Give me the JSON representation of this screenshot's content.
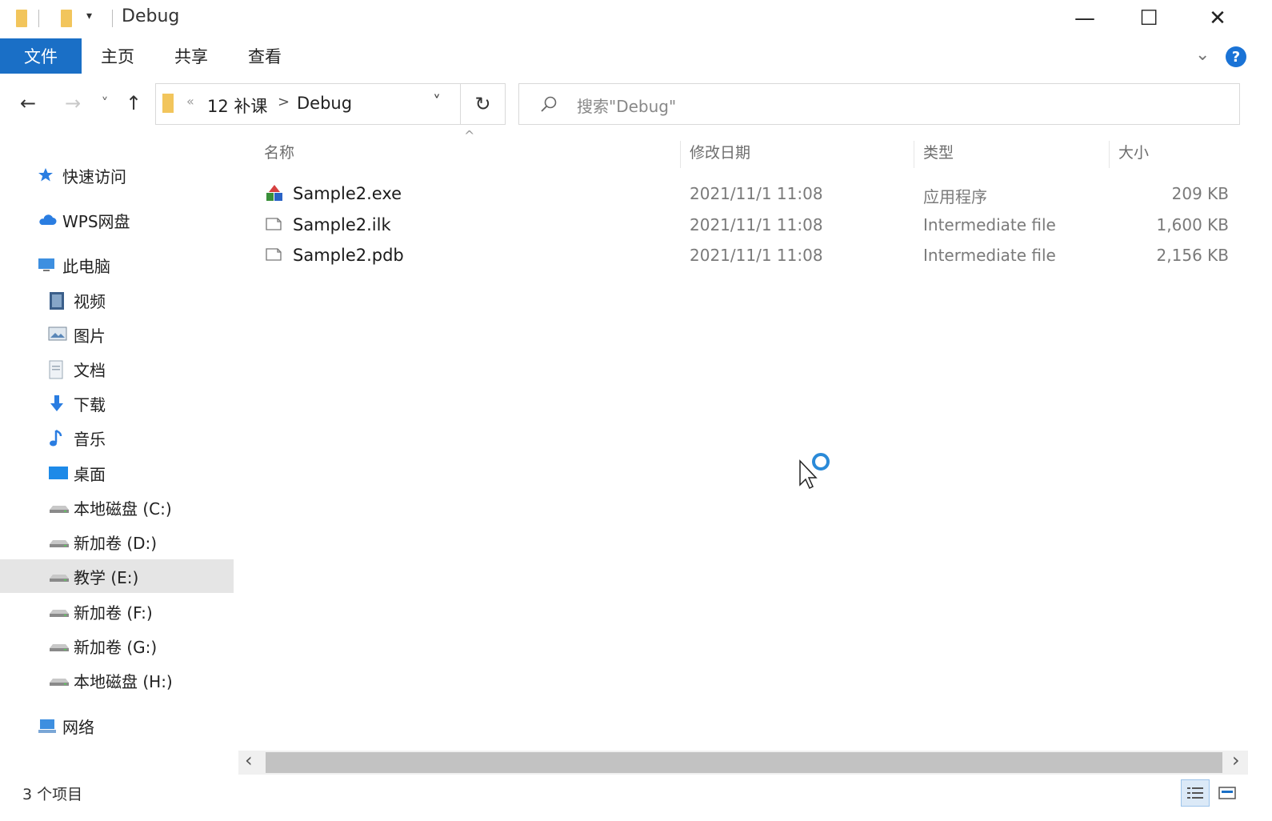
{
  "window": {
    "title": "Debug",
    "minimize_glyph": "—",
    "maximize_glyph": "☐",
    "close_glyph": "✕"
  },
  "ribbon": {
    "tabs": [
      "文件",
      "主页",
      "共享",
      "查看"
    ],
    "help_glyph": "?"
  },
  "nav": {
    "back": "←",
    "forward": "→",
    "recent": "˅",
    "up": "↑",
    "refresh": "↻",
    "address": {
      "overflow": "«",
      "parent": "12 补课",
      "separator": ">",
      "current": "Debug",
      "dropdown": "˅"
    },
    "search_placeholder": "搜索\"Debug\""
  },
  "columns": {
    "name": "名称",
    "date": "修改日期",
    "type": "类型",
    "size": "大小",
    "sort_indicator": "^"
  },
  "files": [
    {
      "name": "Sample2.exe",
      "date": "2021/11/1 11:08",
      "type": "应用程序",
      "size": "209 KB",
      "icon": "app-icon"
    },
    {
      "name": "Sample2.ilk",
      "date": "2021/11/1 11:08",
      "type": "Intermediate file",
      "size": "1,600 KB",
      "icon": "file-icon"
    },
    {
      "name": "Sample2.pdb",
      "date": "2021/11/1 11:08",
      "type": "Intermediate file",
      "size": "2,156 KB",
      "icon": "file-icon"
    }
  ],
  "sidebar": {
    "items": [
      {
        "label": "快速访问",
        "icon": "star-icon"
      },
      {
        "label": "WPS网盘",
        "icon": "cloud-icon"
      },
      {
        "label": "此电脑",
        "icon": "computer-icon"
      },
      {
        "label": "视频",
        "icon": "video-icon"
      },
      {
        "label": "图片",
        "icon": "picture-icon"
      },
      {
        "label": "文档",
        "icon": "document-icon"
      },
      {
        "label": "下载",
        "icon": "download-icon"
      },
      {
        "label": "音乐",
        "icon": "music-icon"
      },
      {
        "label": "桌面",
        "icon": "desktop-icon"
      },
      {
        "label": "本地磁盘 (C:)",
        "icon": "drive-icon"
      },
      {
        "label": "新加卷 (D:)",
        "icon": "drive-icon"
      },
      {
        "label": "教学 (E:)",
        "icon": "drive-icon",
        "selected": true
      },
      {
        "label": "新加卷 (F:)",
        "icon": "drive-icon"
      },
      {
        "label": "新加卷 (G:)",
        "icon": "drive-icon"
      },
      {
        "label": "本地磁盘 (H:)",
        "icon": "drive-icon"
      },
      {
        "label": "网络",
        "icon": "network-icon"
      }
    ]
  },
  "scrollbar": {
    "left": "‹",
    "right": "›"
  },
  "status": {
    "item_count": "3 个项目"
  },
  "colors": {
    "accent": "#1a6fc6",
    "selected_bg": "#e5e5e5",
    "folder": "#f2c55c"
  }
}
